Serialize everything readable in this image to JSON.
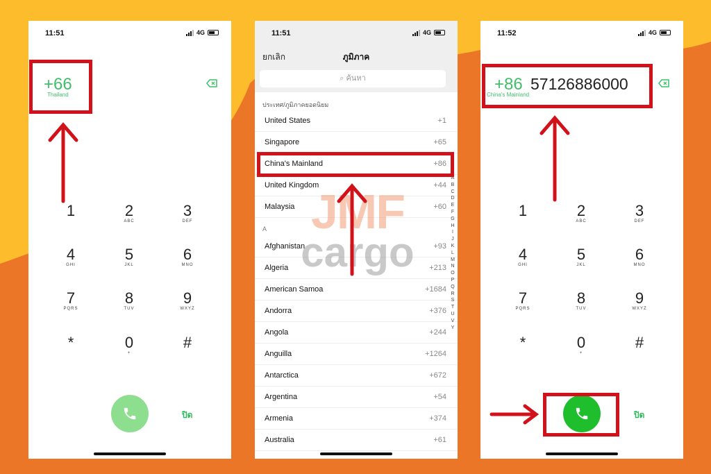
{
  "status": {
    "time_left": "11:51",
    "time_mid": "11:51",
    "time_right": "11:52",
    "network": "4G"
  },
  "keypad": [
    {
      "d": "1",
      "l": ""
    },
    {
      "d": "2",
      "l": "ABC"
    },
    {
      "d": "3",
      "l": "DEF"
    },
    {
      "d": "4",
      "l": "GHI"
    },
    {
      "d": "5",
      "l": "JKL"
    },
    {
      "d": "6",
      "l": "MNO"
    },
    {
      "d": "7",
      "l": "PQRS"
    },
    {
      "d": "8",
      "l": "TUV"
    },
    {
      "d": "9",
      "l": "WXYZ"
    },
    {
      "d": "*",
      "l": ""
    },
    {
      "d": "0",
      "l": "+"
    },
    {
      "d": "#",
      "l": ""
    }
  ],
  "left": {
    "code": "+66",
    "country": "Thailand",
    "close_label": "ปิด"
  },
  "right": {
    "code": "+86",
    "number": "57126886000",
    "country": "China's Mainland",
    "close_label": "ปิด"
  },
  "picker": {
    "cancel": "ยกเลิก",
    "title": "ภูมิภาค",
    "search_placeholder": "ค้นหา",
    "popular_header": "ประเทศ/ภูมิภาคยอดนิยม",
    "section_a": "A",
    "popular": [
      {
        "name": "United States",
        "code": "+1"
      },
      {
        "name": "Singapore",
        "code": "+65"
      },
      {
        "name": "China's Mainland",
        "code": "+86"
      },
      {
        "name": "United Kingdom",
        "code": "+44"
      },
      {
        "name": "Malaysia",
        "code": "+60"
      }
    ],
    "a_list": [
      {
        "name": "Afghanistan",
        "code": "+93"
      },
      {
        "name": "Algeria",
        "code": "+213"
      },
      {
        "name": "American Samoa",
        "code": "+1684"
      },
      {
        "name": "Andorra",
        "code": "+376"
      },
      {
        "name": "Angola",
        "code": "+244"
      },
      {
        "name": "Anguilla",
        "code": "+1264"
      },
      {
        "name": "Antarctica",
        "code": "+672"
      },
      {
        "name": "Argentina",
        "code": "+54"
      },
      {
        "name": "Armenia",
        "code": "+374"
      },
      {
        "name": "Australia",
        "code": "+61"
      }
    ],
    "index": [
      "A",
      "B",
      "C",
      "D",
      "E",
      "F",
      "G",
      "H",
      "I",
      "J",
      "K",
      "L",
      "M",
      "N",
      "O",
      "P",
      "Q",
      "R",
      "S",
      "T",
      "U",
      "V",
      "Y"
    ]
  },
  "watermark": {
    "line1": "JMF",
    "line2": "cargo"
  },
  "colors": {
    "background": "#ec7628",
    "accent_yellow": "#fcbc2b",
    "highlight_red": "#d2121b",
    "ios_green": "#3fbf6a"
  }
}
